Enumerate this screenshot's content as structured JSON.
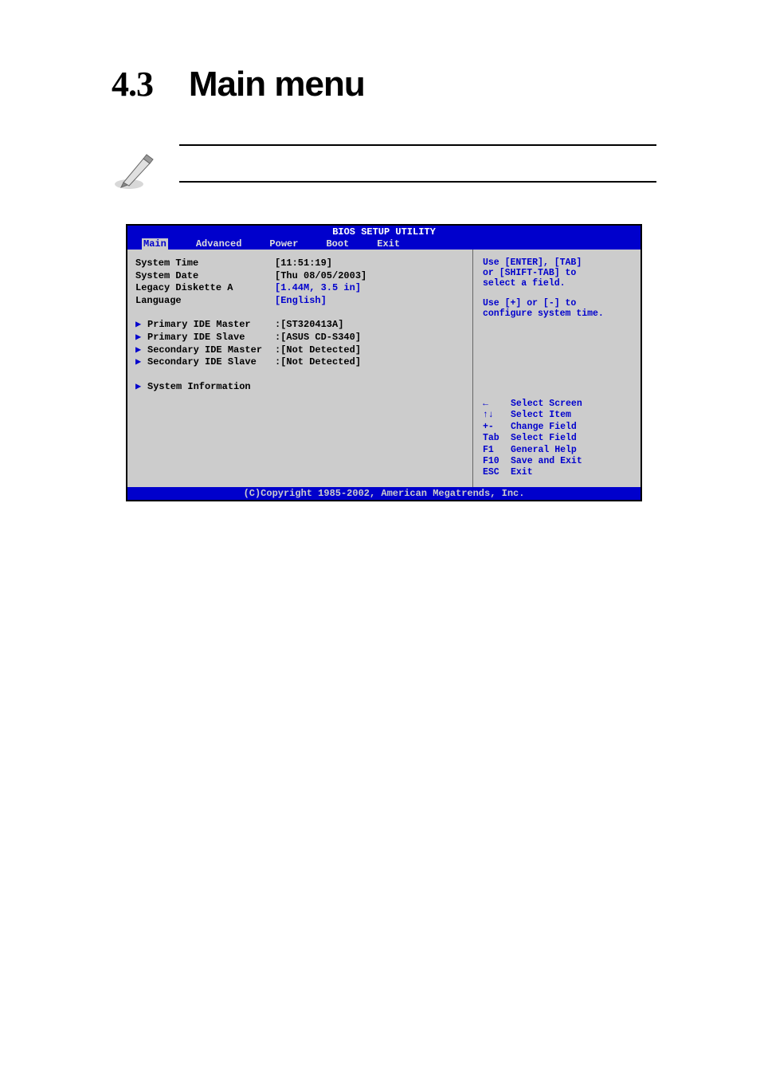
{
  "heading": {
    "number": "4.3",
    "title": "Main menu"
  },
  "bios": {
    "title": "BIOS SETUP UTILITY",
    "menu": {
      "items": [
        "Main",
        "Advanced",
        "Power",
        "Boot",
        "Exit"
      ],
      "selected": "Main"
    },
    "settings": {
      "system_time": {
        "label": "System Time",
        "value": "[11:51:19]"
      },
      "system_date": {
        "label": "System Date",
        "value": "[Thu 08/05/2003]"
      },
      "legacy_diskette_a": {
        "label": "Legacy Diskette A",
        "value": "[1.44M, 3.5 in]"
      },
      "language": {
        "label": "Language",
        "value": "[English]"
      },
      "primary_ide_master": {
        "label": "Primary IDE Master",
        "value": ":[ST320413A]"
      },
      "primary_ide_slave": {
        "label": "Primary IDE Slave",
        "value": ":[ASUS CD-S340]"
      },
      "secondary_ide_master": {
        "label": "Secondary IDE Master",
        "value": ":[Not Detected]"
      },
      "secondary_ide_slave": {
        "label": "Secondary IDE Slave",
        "value": ":[Not Detected]"
      },
      "system_information": {
        "label": "System Information"
      }
    },
    "help_text": {
      "line1": "Use [ENTER], [TAB]",
      "line2": "or [SHIFT-TAB] to",
      "line3": "select a field.",
      "line4": "Use [+] or [-] to",
      "line5": "configure system time."
    },
    "nav_help": {
      "select_screen": {
        "key": "←",
        "label": "Select Screen"
      },
      "select_item": {
        "key": "↑↓",
        "label": "Select Item"
      },
      "change_field": {
        "key": "+-",
        "label": "Change Field"
      },
      "select_field": {
        "key": "Tab",
        "label": "Select Field"
      },
      "general_help": {
        "key": "F1",
        "label": "General Help"
      },
      "save_exit": {
        "key": "F10",
        "label": "Save and Exit"
      },
      "exit": {
        "key": "ESC",
        "label": "Exit"
      }
    },
    "copyright": "(C)Copyright 1985-2002, American Megatrends, Inc."
  }
}
